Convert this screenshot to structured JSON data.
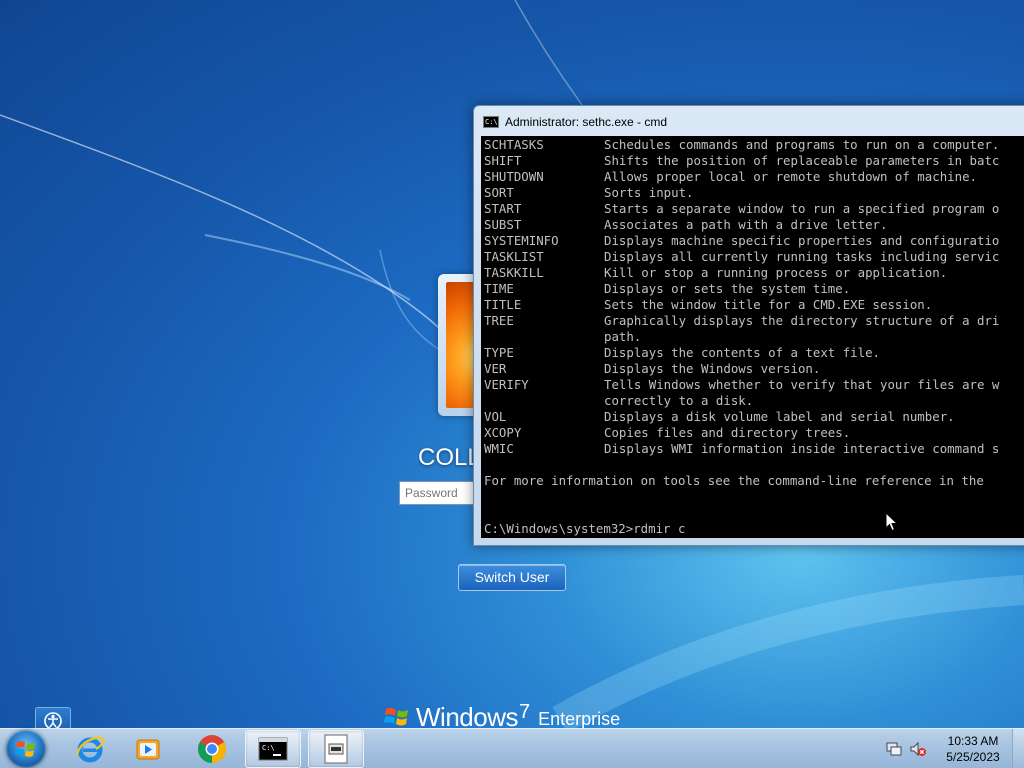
{
  "logon": {
    "username": "COLL",
    "password_placeholder": "Password",
    "switch_user_label": "Switch User",
    "branding": {
      "name": "Windows",
      "version": "7",
      "edition": "Enterprise"
    }
  },
  "cmd_window": {
    "title": "Administrator: sethc.exe - cmd",
    "commands": [
      {
        "cmd": "SCHTASKS",
        "desc": "Schedules commands and programs to run on a computer."
      },
      {
        "cmd": "SHIFT",
        "desc": "Shifts the position of replaceable parameters in batc"
      },
      {
        "cmd": "SHUTDOWN",
        "desc": "Allows proper local or remote shutdown of machine."
      },
      {
        "cmd": "SORT",
        "desc": "Sorts input."
      },
      {
        "cmd": "START",
        "desc": "Starts a separate window to run a specified program o"
      },
      {
        "cmd": "SUBST",
        "desc": "Associates a path with a drive letter."
      },
      {
        "cmd": "SYSTEMINFO",
        "desc": "Displays machine specific properties and configuratio"
      },
      {
        "cmd": "TASKLIST",
        "desc": "Displays all currently running tasks including servic"
      },
      {
        "cmd": "TASKKILL",
        "desc": "Kill or stop a running process or application."
      },
      {
        "cmd": "TIME",
        "desc": "Displays or sets the system time."
      },
      {
        "cmd": "TITLE",
        "desc": "Sets the window title for a CMD.EXE session."
      },
      {
        "cmd": "TREE",
        "desc": "Graphically displays the directory structure of a dri"
      },
      {
        "cmd": "",
        "desc": "path."
      },
      {
        "cmd": "TYPE",
        "desc": "Displays the contents of a text file."
      },
      {
        "cmd": "VER",
        "desc": "Displays the Windows version."
      },
      {
        "cmd": "VERIFY",
        "desc": "Tells Windows whether to verify that your files are w"
      },
      {
        "cmd": "",
        "desc": "correctly to a disk."
      },
      {
        "cmd": "VOL",
        "desc": "Displays a disk volume label and serial number."
      },
      {
        "cmd": "XCOPY",
        "desc": "Copies files and directory trees."
      },
      {
        "cmd": "WMIC",
        "desc": "Displays WMI information inside interactive command s"
      }
    ],
    "footer": "For more information on tools see the command-line reference in the",
    "prompt": "C:\\Windows\\system32>rdmir c"
  },
  "taskbar": {
    "items": [
      {
        "name": "internet-explorer",
        "icon": "ie-icon"
      },
      {
        "name": "media-player",
        "icon": "media-player-icon"
      },
      {
        "name": "chrome",
        "icon": "chrome-icon"
      },
      {
        "name": "cmd",
        "icon": "cmd-icon",
        "active": true
      },
      {
        "name": "sethc",
        "icon": "app-window-icon",
        "active": true
      }
    ],
    "clock_time": "10:33 AM",
    "clock_date": "5/25/2023"
  },
  "colors": {
    "desktop": "#1d6bc3",
    "console_bg": "#000000",
    "console_text": "#c0c0c0",
    "taskbar": "#a7c3e0"
  }
}
